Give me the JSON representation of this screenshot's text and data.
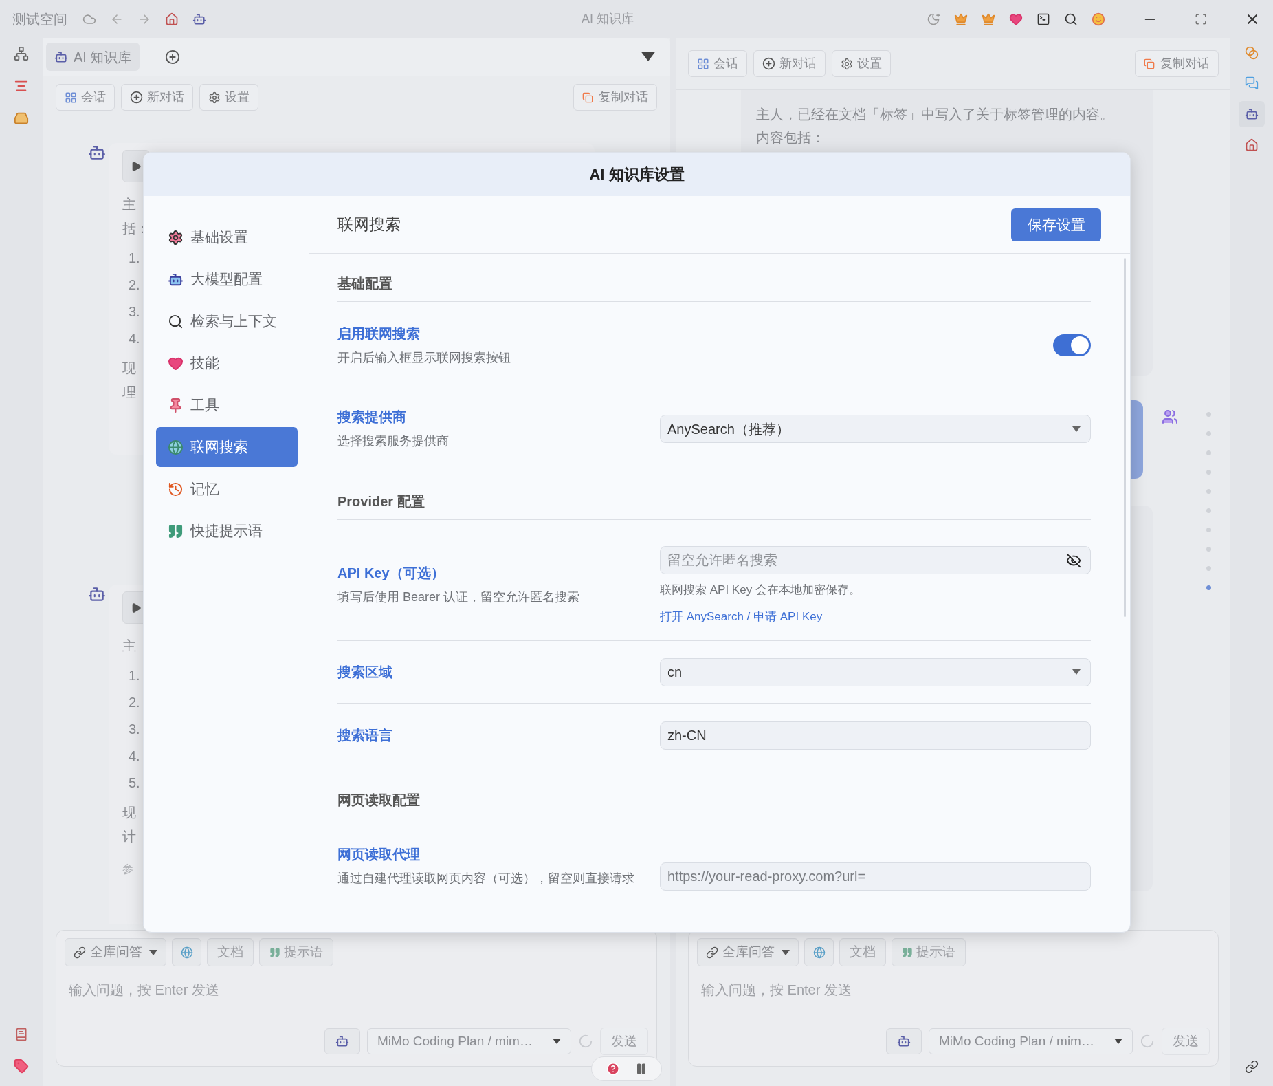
{
  "title_bar": {
    "workspace": "测试空间",
    "title": "AI 知识库"
  },
  "left_pane": {
    "tab": {
      "label": "AI 知识库",
      "selected": true
    },
    "toolbar": [
      {
        "label": "会话"
      },
      {
        "label": "新对话"
      },
      {
        "label": "设置"
      }
    ],
    "copy_button": "复制对话",
    "messages": [
      {
        "fragments": [
          {
            "kind": "text",
            "text": "主"
          },
          {
            "kind": "text",
            "text": "括："
          },
          {
            "kind": "list",
            "text": "1."
          },
          {
            "kind": "list",
            "text": "2."
          },
          {
            "kind": "list",
            "text": "3."
          },
          {
            "kind": "list",
            "text": "4."
          },
          {
            "kind": "text",
            "text": "现"
          },
          {
            "kind": "text",
            "text": "理"
          }
        ]
      },
      {
        "fragments": [
          {
            "kind": "text",
            "text": "主"
          },
          {
            "kind": "list",
            "text": "1."
          },
          {
            "kind": "list",
            "text": "2."
          },
          {
            "kind": "list",
            "text": "3."
          },
          {
            "kind": "list",
            "text": "4."
          },
          {
            "kind": "list",
            "text": "5."
          },
          {
            "kind": "text",
            "text": "现"
          },
          {
            "kind": "text",
            "text": "计"
          },
          {
            "kind": "note",
            "text": "参"
          }
        ]
      }
    ],
    "composer": {
      "mode": "全库问答",
      "chips": [
        "文档",
        "提示语"
      ],
      "placeholder": "输入问题，按 Enter 发送",
      "model": "MiMo Coding Plan / mim…",
      "send": {
        "label": "发送",
        "disabled": true
      }
    }
  },
  "right_pane": {
    "toolbar": [
      {
        "label": "会话"
      },
      {
        "label": "新对话"
      },
      {
        "label": "设置"
      }
    ],
    "copy_button": "复制对话",
    "message_lines": [
      "主人，已经在文档「标签」中写入了关于标签管理的内容。",
      "内容包括："
    ],
    "scroll_markers": [
      {
        "selected": false
      },
      {
        "selected": false
      },
      {
        "selected": false
      },
      {
        "selected": false
      },
      {
        "selected": false
      },
      {
        "selected": false
      },
      {
        "selected": false
      },
      {
        "selected": false
      },
      {
        "selected": false
      },
      {
        "selected": true
      }
    ],
    "composer": {
      "mode": "全库问答",
      "chips": [
        "文档",
        "提示语"
      ],
      "placeholder": "输入问题，按 Enter 发送",
      "model": "MiMo Coding Plan / mim…",
      "send": {
        "label": "发送",
        "disabled": true
      }
    }
  },
  "modal": {
    "title": "AI 知识库设置",
    "nav": [
      {
        "label": "基础设置",
        "selected": false
      },
      {
        "label": "大模型配置",
        "selected": false
      },
      {
        "label": "检索与上下文",
        "selected": false
      },
      {
        "label": "技能",
        "selected": false
      },
      {
        "label": "工具",
        "selected": false
      },
      {
        "label": "联网搜索",
        "selected": true
      },
      {
        "label": "记忆",
        "selected": false
      },
      {
        "label": "快捷提示语",
        "selected": false
      }
    ],
    "page_title": "联网搜索",
    "save_button": "保存设置",
    "sections": [
      {
        "kind": "heading",
        "label": "基础配置"
      },
      {
        "kind": "toggle",
        "label": "启用联网搜索",
        "description": "开启后输入框显示联网搜索按钮",
        "on": true
      },
      {
        "kind": "select",
        "label": "搜索提供商",
        "description": "选择搜索服务提供商",
        "value": "AnySearch（推荐）"
      },
      {
        "kind": "heading",
        "label": "Provider 配置"
      },
      {
        "kind": "secret",
        "label": "API Key（可选）",
        "description": "填写后使用 Bearer 认证，留空允许匿名搜索",
        "placeholder": "留空允许匿名搜索",
        "help": "联网搜索 API Key 会在本地加密保存。",
        "link": "打开 AnySearch / 申请 API Key"
      },
      {
        "kind": "select",
        "label": "搜索区域",
        "value": "cn"
      },
      {
        "kind": "input",
        "label": "搜索语言",
        "value": "zh-CN"
      },
      {
        "kind": "heading",
        "label": "网页读取配置"
      },
      {
        "kind": "input",
        "label": "网页读取代理",
        "description": "通过自建代理读取网页内容（可选），留空则直接请求",
        "placeholder": "https://your-read-proxy.com?url="
      }
    ]
  }
}
